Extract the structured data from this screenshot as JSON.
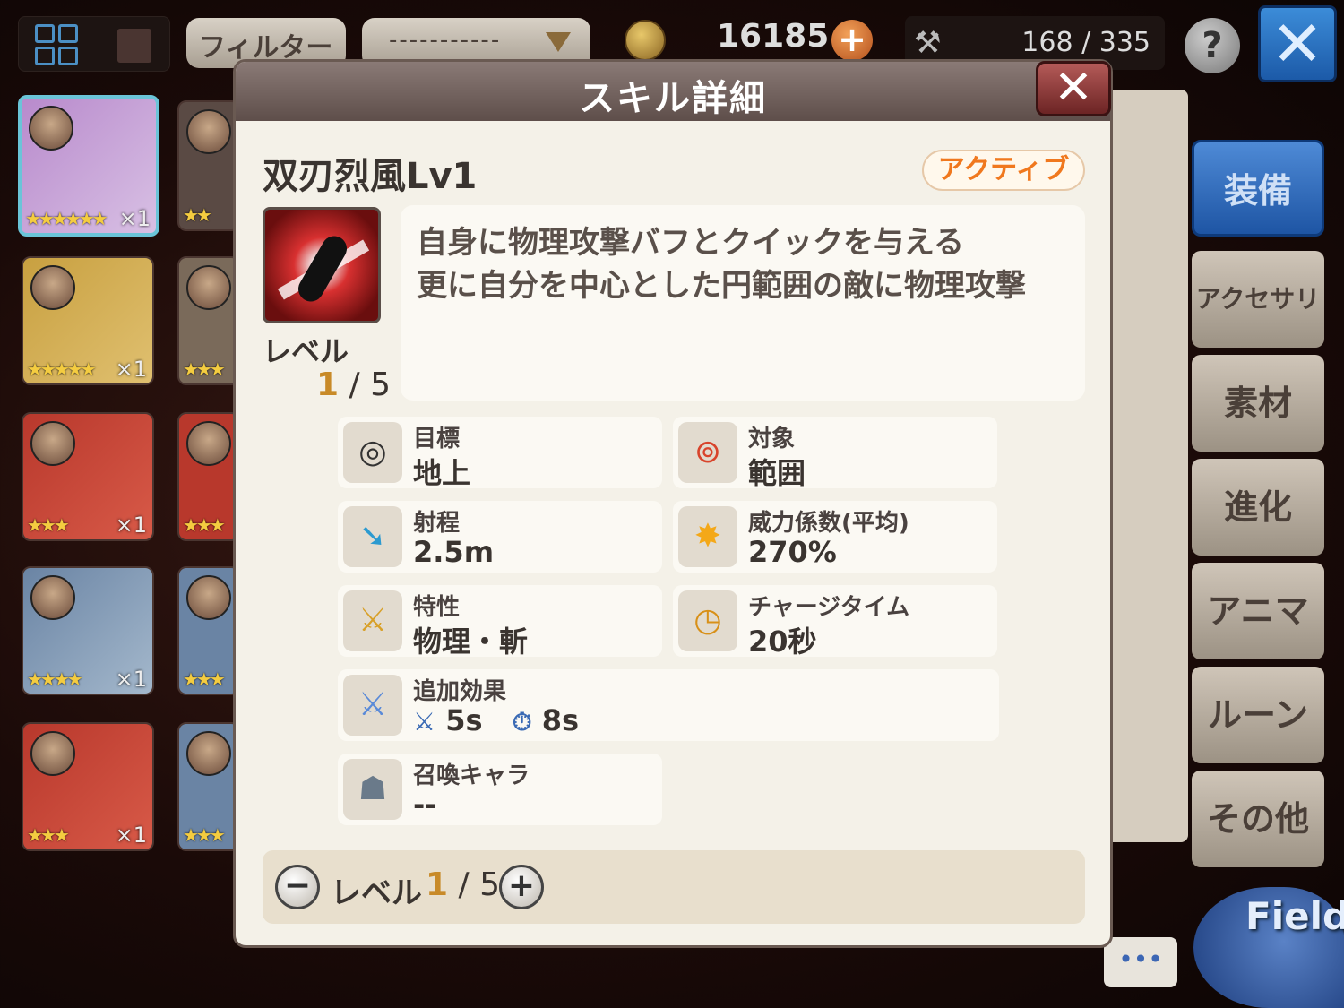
{
  "topbar": {
    "filter_label": "フィルター",
    "sort_value": "-----------",
    "gil": "16185",
    "inventory": "168 / 335",
    "help_label": "?",
    "close_label": "✕",
    "plus_label": "+"
  },
  "inventory": {
    "items": [
      {
        "stars": "★★★★★★",
        "qty": "×1",
        "color": "#b88acc"
      },
      {
        "stars": "★★",
        "qty": "",
        "color": "#5a4a44"
      },
      {
        "stars": "★★★★★",
        "qty": "×1",
        "color": "#c8a040"
      },
      {
        "stars": "★★★",
        "qty": "",
        "color": "#5a4a44"
      },
      {
        "stars": "★★★",
        "qty": "×1",
        "color": "#b8382c"
      },
      {
        "stars": "★★★",
        "qty": "",
        "color": "#b8382c"
      },
      {
        "stars": "★★★★",
        "qty": "×1",
        "color": "#6a84a4"
      },
      {
        "stars": "★★★",
        "qty": "",
        "color": "#6a84a4"
      },
      {
        "stars": "★★★",
        "qty": "×1",
        "color": "#b8382c"
      },
      {
        "stars": "★★★",
        "qty": "",
        "color": "#6a84a4"
      }
    ]
  },
  "side_tabs": {
    "equip": "装備",
    "accessory": "アクセサリ",
    "material": "素材",
    "evolve": "進化",
    "anima": "アニマ",
    "rune": "ルーン",
    "other": "その他"
  },
  "field_label": "Field",
  "chat_label": "•••",
  "modal": {
    "title": "スキル詳細",
    "close_label": "✕",
    "skill_name": "双刃烈風Lv1",
    "type_badge": "アクティブ",
    "level_label": "レベル",
    "level_current": "1",
    "level_max": "/ 5",
    "description": [
      "自身に物理攻撃バフとクイックを与える",
      "更に自分を中心とした円範囲の敵に物理攻撃"
    ],
    "stats": {
      "target": {
        "label": "目標",
        "value": "地上"
      },
      "object": {
        "label": "対象",
        "value": "範囲"
      },
      "range": {
        "label": "射程",
        "value": "2.5m"
      },
      "power": {
        "label": "威力係数(平均)",
        "value": "270%"
      },
      "attribute": {
        "label": "特性",
        "value": "物理・斬"
      },
      "charge": {
        "label": "チャージタイム",
        "value": "20秒"
      },
      "extra": {
        "label": "追加効果",
        "effects": [
          {
            "icon": "sword-buff-icon",
            "value": "5s"
          },
          {
            "icon": "quick-clock-icon",
            "value": "8s"
          }
        ]
      },
      "summon": {
        "label": "召喚キャラ",
        "value": "--"
      }
    },
    "level_bar": {
      "label": "レベル",
      "current": "1",
      "max": "/ 5",
      "minus": "−",
      "plus": "+"
    }
  }
}
